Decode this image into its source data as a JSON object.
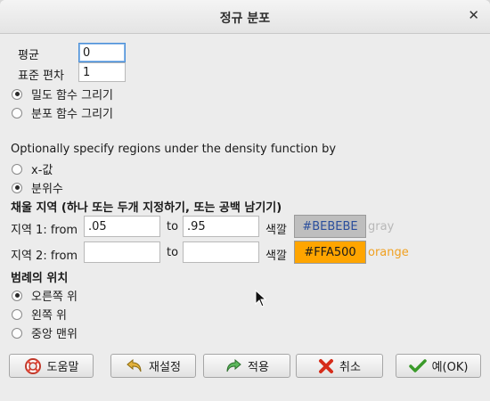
{
  "window": {
    "title": "정규 분포"
  },
  "params": {
    "mean_label": "평균",
    "mean_value": "0",
    "sd_label": "표준 편차",
    "sd_value": "1"
  },
  "plot_type": {
    "density_label": "밀도 함수 그리기",
    "distribution_label": "분포 함수 그리기"
  },
  "region_spec": {
    "heading": "Optionally specify regions under the density function by",
    "x_label": "x-값",
    "quantile_label": "분위수"
  },
  "fill": {
    "heading": "채울 지역 (하나 또는 두개 지정하기, 또는 공백 남기기)",
    "region1": {
      "label": "지역 1: from",
      "from": ".05",
      "to_label": "to",
      "to": ".95",
      "color_label": "색깔",
      "hex": "#BEBEBE",
      "name": "gray",
      "swatch_text_color": "#2a4e9c",
      "name_color": "#b8b8b8"
    },
    "region2": {
      "label": "지역 2: from",
      "from": "",
      "to_label": "to",
      "to": "",
      "color_label": "색깔",
      "hex": "#FFA500",
      "name": "orange",
      "swatch_text_color": "#1a1a1a",
      "name_color": "#f0a020"
    }
  },
  "legend": {
    "heading": "범례의 위치",
    "top_right": "오른쪽 위",
    "top_left": "왼쪽 위",
    "top_center": "중앙 맨위"
  },
  "buttons": {
    "help": "도움말",
    "reset": "재설정",
    "apply": "적용",
    "cancel": "취소",
    "ok": "예(OK)"
  }
}
